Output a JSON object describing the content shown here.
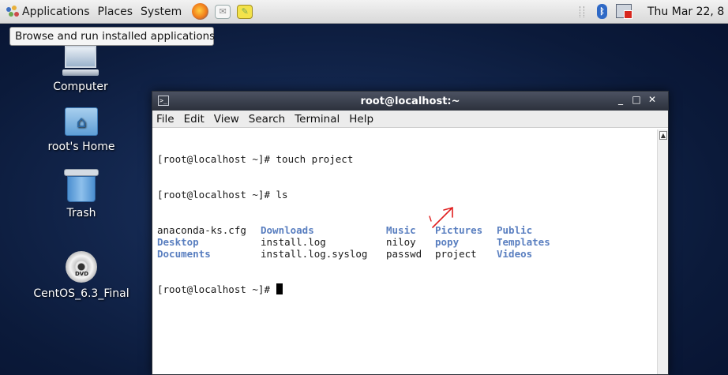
{
  "top_panel": {
    "menus": [
      "Applications",
      "Places",
      "System"
    ],
    "clock": "Thu Mar 22, 8"
  },
  "tooltip": "Browse and run installed applications",
  "desktop_icons": [
    {
      "label": "Computer",
      "icon": "computer-icon"
    },
    {
      "label": "root's Home",
      "icon": "home-folder-icon"
    },
    {
      "label": "Trash",
      "icon": "trash-icon"
    },
    {
      "label": "CentOS_6.3_Final",
      "icon": "dvd-icon",
      "badge": "DVD"
    }
  ],
  "terminal": {
    "title": "root@localhost:~",
    "menu": [
      "File",
      "Edit",
      "View",
      "Search",
      "Terminal",
      "Help"
    ],
    "lines": [
      "[root@localhost ~]# touch project",
      "[root@localhost ~]# ls"
    ],
    "ls_rows": [
      [
        {
          "text": "anaconda-ks.cfg",
          "dir": false
        },
        {
          "text": "Downloads",
          "dir": true
        },
        {
          "text": "Music",
          "dir": true
        },
        {
          "text": "Pictures",
          "dir": true
        },
        {
          "text": "Public",
          "dir": true
        }
      ],
      [
        {
          "text": "Desktop",
          "dir": true
        },
        {
          "text": "install.log",
          "dir": false
        },
        {
          "text": "niloy",
          "dir": false
        },
        {
          "text": "popy",
          "dir": true
        },
        {
          "text": "Templates",
          "dir": true
        }
      ],
      [
        {
          "text": "Documents",
          "dir": true
        },
        {
          "text": "install.log.syslog",
          "dir": false
        },
        {
          "text": "passwd",
          "dir": false
        },
        {
          "text": "project",
          "dir": false
        },
        {
          "text": "Videos",
          "dir": true
        }
      ]
    ],
    "prompt": "[root@localhost ~]# "
  },
  "colors": {
    "directory": "#5a7fc0",
    "annotation": "#e02020"
  }
}
